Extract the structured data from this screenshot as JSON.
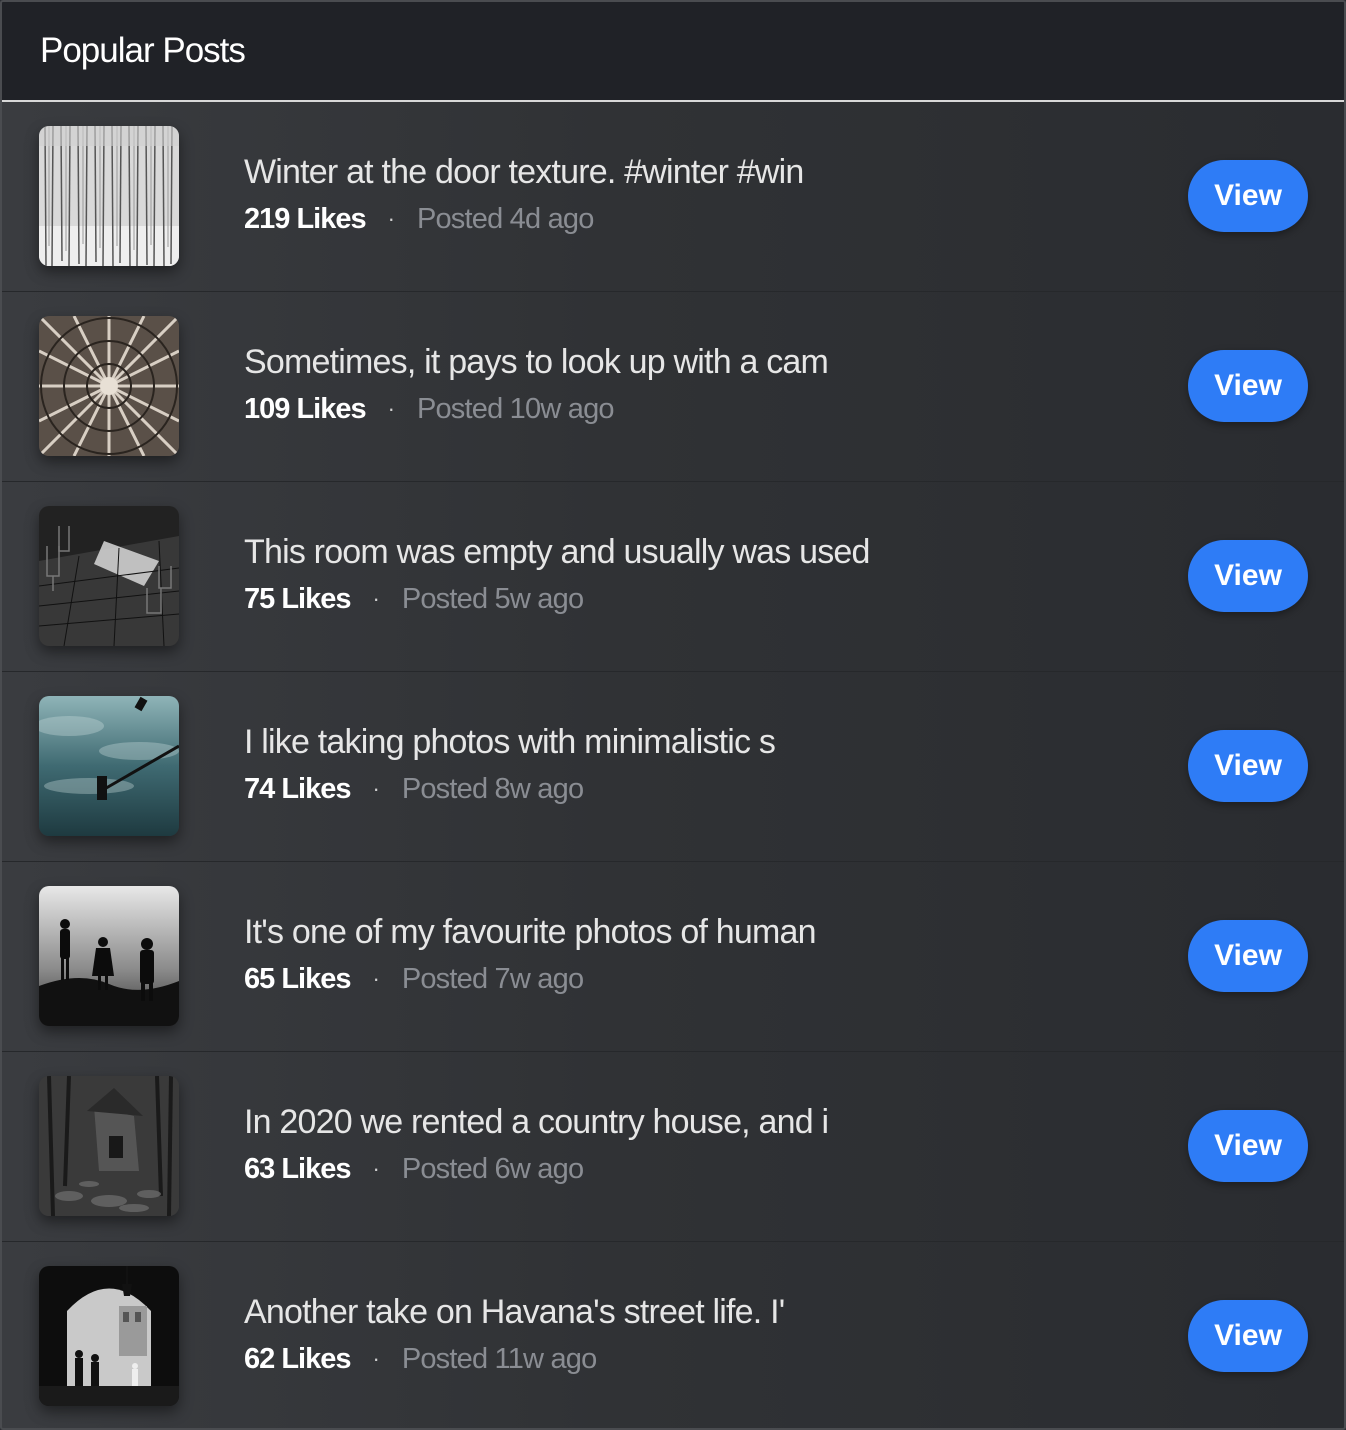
{
  "header": {
    "title": "Popular Posts"
  },
  "posts": [
    {
      "thumbnail_icon": "birch-forest-image",
      "title": "Winter at the door texture. #winter #win",
      "likes": "219 Likes",
      "separator": "·",
      "posted": "Posted 4d ago",
      "button_label": "View"
    },
    {
      "thumbnail_icon": "vaulted-ceiling-image",
      "title": "Sometimes, it pays to look up with a cam",
      "likes": "109 Likes",
      "separator": "·",
      "posted": "Posted 10w ago",
      "button_label": "View"
    },
    {
      "thumbnail_icon": "empty-room-chairs-image",
      "title": "This room was empty and usually was used",
      "likes": "75 Likes",
      "separator": "·",
      "posted": "Posted 5w ago",
      "button_label": "View"
    },
    {
      "thumbnail_icon": "traffic-light-sky-image",
      "title": "I like taking photos with minimalistic s",
      "likes": "74 Likes",
      "separator": "·",
      "posted": "Posted 8w ago",
      "button_label": "View"
    },
    {
      "thumbnail_icon": "silhouette-people-image",
      "title": "It's one of my favourite photos of human",
      "likes": "65 Likes",
      "separator": "·",
      "posted": "Posted 7w ago",
      "button_label": "View"
    },
    {
      "thumbnail_icon": "forest-house-image",
      "title": "In 2020 we rented a country house, and i",
      "likes": "63 Likes",
      "separator": "·",
      "posted": "Posted 6w ago",
      "button_label": "View"
    },
    {
      "thumbnail_icon": "havana-street-arch-image",
      "title": "Another take on Havana's street life. I'",
      "likes": "62 Likes",
      "separator": "·",
      "posted": "Posted 11w ago",
      "button_label": "View"
    }
  ],
  "colors": {
    "header_bg": "#202227",
    "button_bg": "#2e7cf6",
    "posted_text": "#8a8d93",
    "title_text": "#e6e6e6"
  }
}
